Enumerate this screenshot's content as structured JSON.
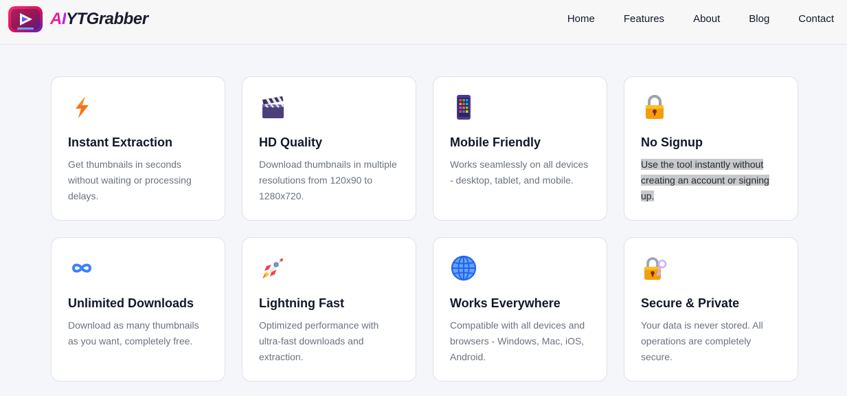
{
  "brand": {
    "ai": "AI",
    "rest": "YTGrabber"
  },
  "nav": [
    {
      "label": "Home"
    },
    {
      "label": "Features"
    },
    {
      "label": "About"
    },
    {
      "label": "Blog"
    },
    {
      "label": "Contact"
    }
  ],
  "features": [
    {
      "icon": "lightning-icon",
      "title": "Instant Extraction",
      "desc": "Get thumbnails in seconds without waiting or processing delays."
    },
    {
      "icon": "clapper-board-icon",
      "title": "HD Quality",
      "desc": "Download thumbnails in multiple resolutions from 120x90 to 1280x720."
    },
    {
      "icon": "mobile-phone-icon",
      "title": "Mobile Friendly",
      "desc": "Works seamlessly on all devices - desktop, tablet, and mobile."
    },
    {
      "icon": "lock-icon",
      "title": "No Signup",
      "desc": "Use the tool instantly without creating an account or signing up."
    },
    {
      "icon": "infinity-icon",
      "title": "Unlimited Downloads",
      "desc": "Download as many thumbnails as you want, completely free."
    },
    {
      "icon": "rocket-icon",
      "title": "Lightning Fast",
      "desc": "Optimized performance with ultra-fast downloads and extraction."
    },
    {
      "icon": "globe-icon",
      "title": "Works Everywhere",
      "desc": "Compatible with all devices and browsers - Windows, Mac, iOS, Android."
    },
    {
      "icon": "lock-with-key-icon",
      "title": "Secure & Private",
      "desc": "Your data is never stored. All operations are completely secure."
    }
  ],
  "colors": {
    "background": "#f5f6f9",
    "card": "#ffffff",
    "title": "#111827",
    "description": "#6b7280",
    "brand_gradient_start": "#ff1f6d",
    "brand_gradient_end": "#c21fe0",
    "selection": "#c9c9c9"
  }
}
